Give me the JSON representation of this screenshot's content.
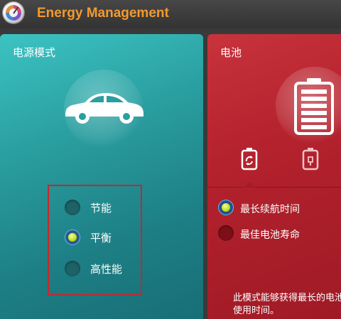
{
  "app": {
    "title": "Energy Management"
  },
  "power": {
    "heading": "电源模式",
    "modes": [
      {
        "label": "节能",
        "selected": false
      },
      {
        "label": "平衡",
        "selected": true
      },
      {
        "label": "高性能",
        "selected": false
      }
    ]
  },
  "battery": {
    "heading": "电池",
    "options": [
      {
        "label": "最长续航时间",
        "selected": true
      },
      {
        "label": "最佳电池寿命",
        "selected": false
      }
    ],
    "description": "此模式能够获得最长的电池使用时间。"
  },
  "icons": {
    "app_logo": "gauge-logo",
    "power_illustration": "car-icon",
    "battery_illustration": "battery-icon",
    "battery_tab_1": "battery-recycle-icon",
    "battery_tab_2": "battery-lock-icon"
  },
  "colors": {
    "title": "#f39a2e",
    "teal_panel": "#2a9ea0",
    "red_panel": "#b4222d",
    "highlight_box": "#c8262d",
    "selected_dot": "#b8e21c"
  }
}
